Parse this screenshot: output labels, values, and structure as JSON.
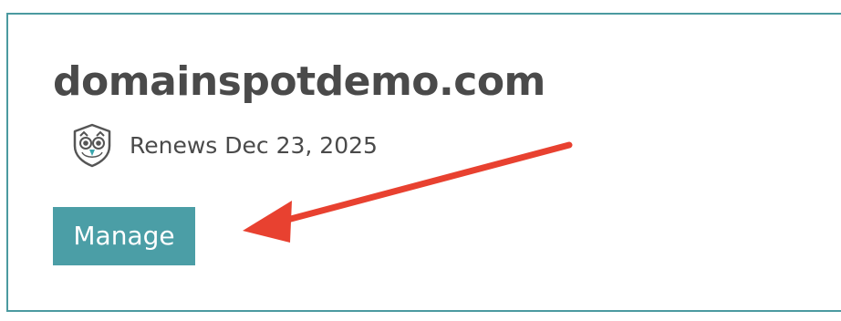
{
  "domain_card": {
    "domain_name": "domainspotdemo.com",
    "renewal_text": "Renews Dec 23, 2025",
    "manage_label": "Manage",
    "icon": "owl-shield-icon"
  },
  "annotation": {
    "arrow_color": "#e84130",
    "arrow_target": "manage-button"
  },
  "colors": {
    "card_border": "#4b9aa0",
    "button_background": "#4b9ea6",
    "button_text": "#ffffff",
    "title_text": "#4a4a4a"
  }
}
